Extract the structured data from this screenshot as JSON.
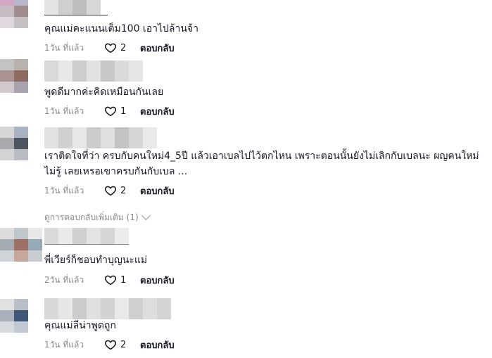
{
  "comments": [
    {
      "text": "คุณแม่คะแนนเต็ม100 เอาไปล้านจ้า",
      "time": "1วัน ที่แล้ว",
      "likes": "2",
      "reply_label": "ตอบกลับ"
    },
    {
      "text": "พูดดีมากค่ะคิดเหมือนกันเลย",
      "time": "1วัน ที่แล้ว",
      "likes": "1",
      "reply_label": "ตอบกลับ"
    },
    {
      "text": "เราติดใจที่ว่า ครบกับคนใหม่4_5ปี แล้วเอาเบลไปไว้ตกไหน เพราะตอนนั้นยังไม่เลิกกับเบลนะ ผญคนใหม่ไม่รู้ เลยเหรอเขาครบกันกับเบล ...",
      "time": "1วัน ที่แล้ว",
      "likes": "2",
      "reply_label": "ตอบกลับ",
      "view_more_replies": "ดูการตอบกลับเพิ่มเติม (1)"
    },
    {
      "text": "พี่เวียร์ก็ชอบทำบุญนะแม่",
      "time": "2วัน ที่แล้ว",
      "likes": "1",
      "reply_label": "ตอบกลับ"
    },
    {
      "text": "คุณแม่ลีน่าพูดถูก",
      "time": "1วัน ที่แล้ว",
      "likes": "2",
      "reply_label": "ตอบกลับ"
    }
  ],
  "icons": {
    "like": "heart-outline-icon",
    "expand": "chevron-down-icon"
  },
  "colors": {
    "text_primary": "#161823",
    "text_secondary": "#8a8b91"
  }
}
